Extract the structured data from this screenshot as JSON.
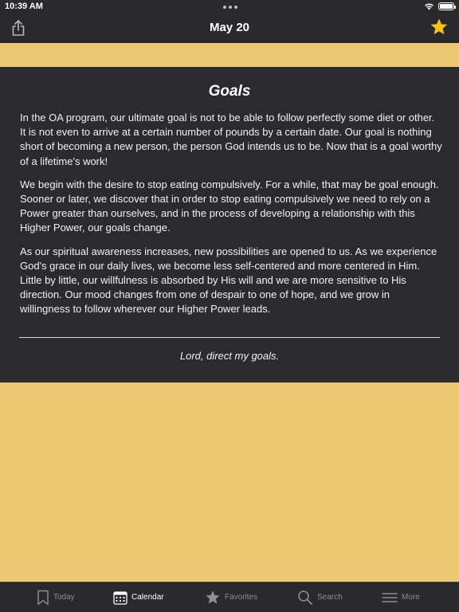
{
  "status_bar": {
    "time": "10:39 AM",
    "battery_level": 1.0
  },
  "nav": {
    "title": "May 20",
    "share_icon": "share-icon",
    "favorite_icon": "star-icon",
    "favorite_color": "#f5c518"
  },
  "reading": {
    "title": "Goals",
    "paragraphs": [
      "In the OA program, our ultimate goal is not to be able to follow perfectly some diet or other. It is not even to arrive at a certain number of pounds by a certain date. Our goal is nothing short of becoming a new person, the person God intends us to be. Now that is a goal worthy of a lifetime's work!",
      "We begin with the desire to stop eating compulsively. For a while, that may be goal enough. Sooner or later, we discover that in order to stop eating compulsively we need to rely on a Power greater than ourselves, and in the process of developing a relationship with this Higher Power, our goals change.",
      "As our spiritual awareness increases, new possibilities are opened to us. As we experience God's grace in our daily lives, we become less self-centered and more centered in Him. Little by little, our willfulness is absorbed by His will and we are more sensitive to His direction. Our mood changes from one of despair to one of hope, and we grow in willingness to follow wherever our Higher Power leads."
    ],
    "prayer": "Lord, direct my goals."
  },
  "tabs": [
    {
      "label": "Today",
      "icon": "bookmark-icon",
      "active": false
    },
    {
      "label": "Calendar",
      "icon": "calendar-icon",
      "active": true
    },
    {
      "label": "Favorites",
      "icon": "star-icon",
      "active": false
    },
    {
      "label": "Search",
      "icon": "search-icon",
      "active": false
    },
    {
      "label": "More",
      "icon": "menu-icon",
      "active": false
    }
  ],
  "colors": {
    "accent_gold": "#ecc872",
    "card_background": "#2b2b2d",
    "bar_background": "#2a2a2c",
    "inactive_tab": "#8e8e93"
  }
}
